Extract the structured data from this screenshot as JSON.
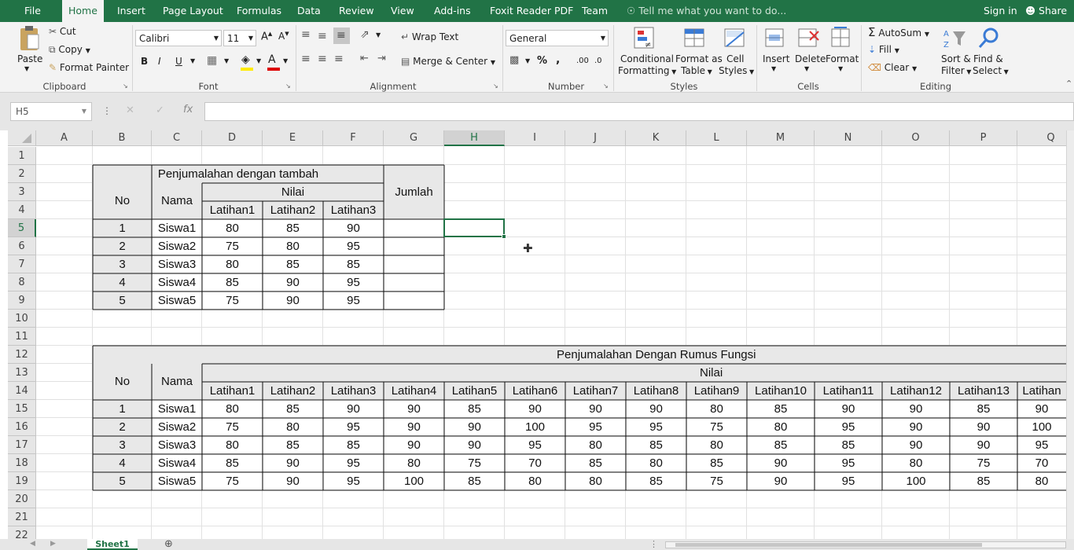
{
  "tabs": [
    "File",
    "Home",
    "Insert",
    "Page Layout",
    "Formulas",
    "Data",
    "Review",
    "View",
    "Add-ins",
    "Foxit Reader PDF",
    "Team"
  ],
  "tell_me": "Tell me what you want to do...",
  "sign_in": "Sign in",
  "share": "Share",
  "clipboard": {
    "paste": "Paste",
    "cut": "Cut",
    "copy": "Copy",
    "format_painter": "Format Painter",
    "label": "Clipboard"
  },
  "font": {
    "name": "Calibri",
    "size": "11",
    "label": "Font",
    "bold": "B",
    "italic": "I",
    "underline": "U"
  },
  "alignment": {
    "wrap_text": "Wrap Text",
    "merge_center": "Merge & Center",
    "label": "Alignment"
  },
  "number": {
    "format": "General",
    "percent": "%",
    "comma": ",",
    "inc_decimal": ".00",
    "dec_decimal": ".0",
    "label": "Number"
  },
  "styles": {
    "conditional": "Conditional",
    "formatting": "Formatting",
    "format_as": "Format as",
    "table": "Table",
    "cell": "Cell",
    "cell_styles": "Styles",
    "label": "Styles"
  },
  "cells": {
    "insert": "Insert",
    "delete": "Delete",
    "format": "Format",
    "label": "Cells"
  },
  "editing": {
    "autosum": "AutoSum",
    "fill": "Fill",
    "clear": "Clear",
    "sort": "Sort &",
    "filter": "Filter",
    "find": "Find &",
    "select": "Select",
    "label": "Editing"
  },
  "name_box": "H5",
  "fx_symbol": "fx",
  "columns": [
    "A",
    "B",
    "C",
    "D",
    "E",
    "F",
    "G",
    "H",
    "I",
    "J",
    "K",
    "L",
    "M",
    "N",
    "O",
    "P",
    "Q"
  ],
  "rows": [
    "1",
    "2",
    "3",
    "4",
    "5",
    "6",
    "7",
    "8",
    "9",
    "10",
    "11",
    "12",
    "13",
    "14",
    "15",
    "16",
    "17",
    "18",
    "19",
    "20",
    "21",
    "22"
  ],
  "table1": {
    "title": "Penjumalahan dengan tambah",
    "no": "No",
    "nama": "Nama",
    "nilai": "Nilai",
    "jumlah": "Jumlah",
    "subheaders": [
      "Latihan1",
      "Latihan2",
      "Latihan3"
    ],
    "rows": [
      [
        "1",
        "Siswa1",
        "80",
        "85",
        "90"
      ],
      [
        "2",
        "Siswa2",
        "75",
        "80",
        "95"
      ],
      [
        "3",
        "Siswa3",
        "80",
        "85",
        "85"
      ],
      [
        "4",
        "Siswa4",
        "85",
        "90",
        "95"
      ],
      [
        "5",
        "Siswa5",
        "75",
        "90",
        "95"
      ]
    ]
  },
  "table2": {
    "title": "Penjumalahan Dengan Rumus Fungsi",
    "no": "No",
    "nama": "Nama",
    "nilai": "Nilai",
    "subheaders": [
      "Latihan1",
      "Latihan2",
      "Latihan3",
      "Latihan4",
      "Latihan5",
      "Latihan6",
      "Latihan7",
      "Latihan8",
      "Latihan9",
      "Latihan10",
      "Latihan11",
      "Latihan12",
      "Latihan13",
      "Latihan"
    ],
    "rows": [
      [
        "1",
        "Siswa1",
        "80",
        "85",
        "90",
        "90",
        "85",
        "90",
        "90",
        "90",
        "80",
        "85",
        "90",
        "90",
        "85",
        "90"
      ],
      [
        "2",
        "Siswa2",
        "75",
        "80",
        "95",
        "90",
        "90",
        "100",
        "95",
        "95",
        "75",
        "80",
        "95",
        "90",
        "90",
        "100"
      ],
      [
        "3",
        "Siswa3",
        "80",
        "85",
        "85",
        "90",
        "90",
        "95",
        "80",
        "85",
        "80",
        "85",
        "85",
        "90",
        "90",
        "95"
      ],
      [
        "4",
        "Siswa4",
        "85",
        "90",
        "95",
        "80",
        "75",
        "70",
        "85",
        "80",
        "85",
        "90",
        "95",
        "80",
        "75",
        "70"
      ],
      [
        "5",
        "Siswa5",
        "75",
        "90",
        "95",
        "100",
        "85",
        "80",
        "80",
        "85",
        "75",
        "90",
        "95",
        "100",
        "85",
        "80"
      ]
    ]
  },
  "sheet_tab": "Sheet1"
}
